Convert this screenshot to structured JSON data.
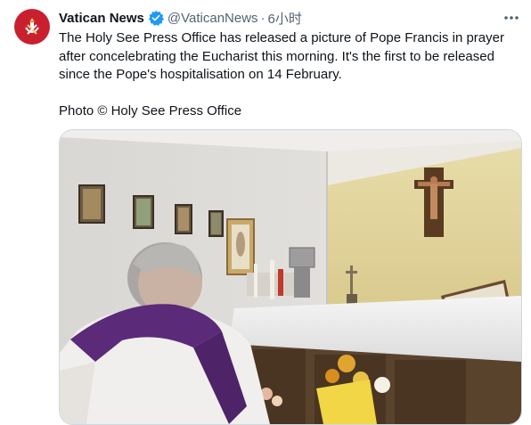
{
  "account": {
    "name": "Vatican News",
    "handle": "@VaticanNews",
    "separator": "·",
    "time": "6小时",
    "verified": true,
    "avatar_icon": "vatican-logo-icon",
    "avatar_color": "#c8202f"
  },
  "tweet": {
    "text": "The Holy See Press Office has released a picture of Pope Francis in prayer after concelebrating the Eucharist this morning. It's the first to be released since the Pope's hospitalisation on 14 February.",
    "credit": "Photo © Holy See Press Office"
  },
  "menu_icon": "more-horizontal-icon",
  "media": {
    "type": "photo",
    "icon": "photo-image"
  },
  "colors": {
    "text": "#0f1419",
    "secondary": "#536471",
    "verified": "#1d9bf0"
  }
}
